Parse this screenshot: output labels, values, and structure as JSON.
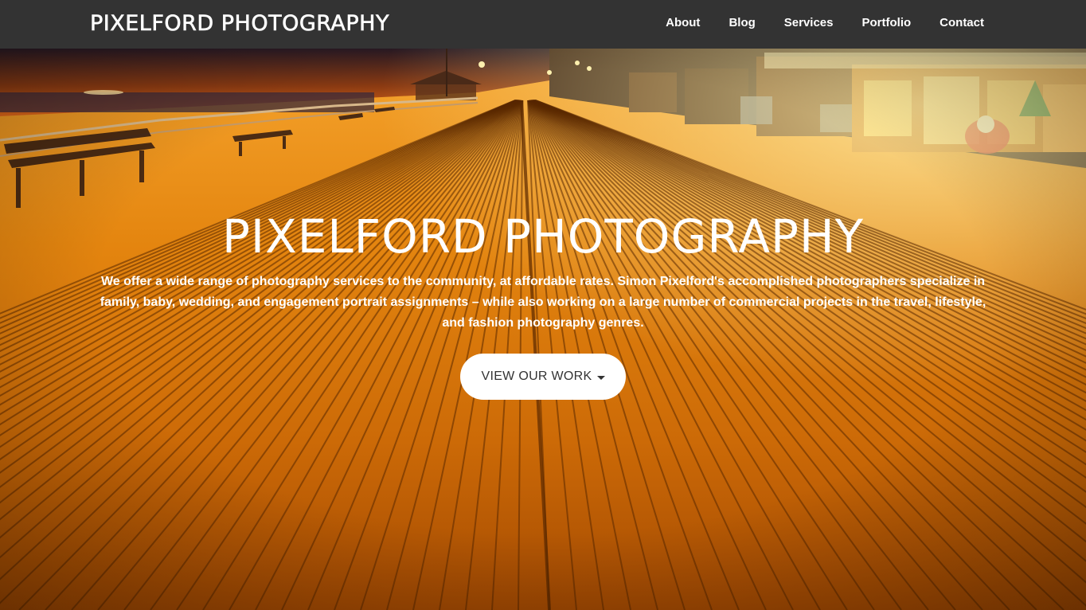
{
  "navbar": {
    "brand": "PIXELFORD PHOTOGRAPHY",
    "links": [
      "About",
      "Blog",
      "Services",
      "Portfolio",
      "Contact"
    ]
  },
  "hero": {
    "title": "PIXELFORD PHOTOGRAPHY",
    "text": "We offer a wide range of photography services to the community, at affordable rates. Simon Pixelford's accomplished photographers specialize in family, baby, wedding, and engagement portrait assignments – while also working on a large number of commercial projects in the travel, lifestyle, and fashion photography genres.",
    "cta_label": "VIEW OUR WORK",
    "cta_icon": "caret-down-icon",
    "background": "boardwalk-at-dusk-photo"
  },
  "colors": {
    "navbar": "#333333",
    "nav_text": "#ffffff",
    "button_bg": "#ffffff",
    "button_text": "#333333",
    "photo_tone": "#d9780e"
  }
}
